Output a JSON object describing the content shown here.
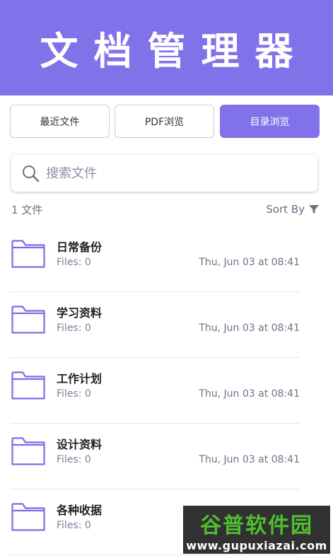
{
  "header": {
    "title": "文档管理器"
  },
  "tabs": [
    {
      "label": "最近文件",
      "active": false
    },
    {
      "label": "PDF浏览",
      "active": false
    },
    {
      "label": "目录浏览",
      "active": true
    }
  ],
  "search": {
    "placeholder": "搜索文件"
  },
  "summary": {
    "count": "1 文件",
    "sort_label": "Sort By"
  },
  "folders": [
    {
      "name": "日常备份",
      "files": "Files: 0",
      "date": "Thu, Jun 03 at 08:41"
    },
    {
      "name": "学习资料",
      "files": "Files: 0",
      "date": "Thu, Jun 03 at 08:41"
    },
    {
      "name": "工作计划",
      "files": "Files: 0",
      "date": "Thu, Jun 03 at 08:41"
    },
    {
      "name": "设计资料",
      "files": "Files: 0",
      "date": "Thu, Jun 03 at 08:41"
    },
    {
      "name": "各种收据",
      "files": "Files: 0",
      "date": ""
    }
  ],
  "watermark": {
    "title": "谷普软件园",
    "url": "www.gupuxiazai.com"
  },
  "colors": {
    "accent": "#8172e9",
    "folder_stroke": "#7a6de6",
    "text_muted": "#6a7086"
  },
  "icons": {
    "search": "search-icon",
    "sort": "filter-icon",
    "folder": "folder-icon"
  }
}
